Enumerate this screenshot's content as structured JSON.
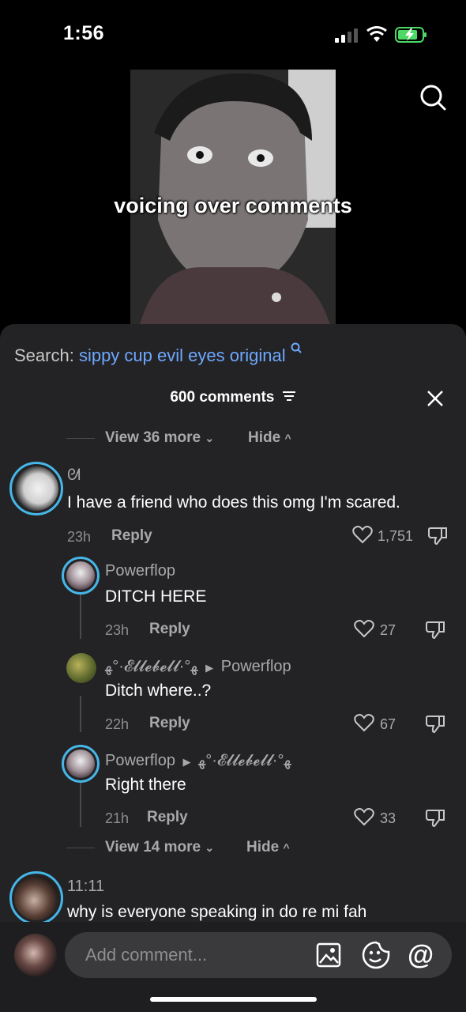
{
  "status_bar": {
    "time": "1:56"
  },
  "video": {
    "caption": "voicing over comments"
  },
  "search": {
    "prefix": "Search:",
    "query": "sippy cup evil eyes original"
  },
  "comments_header": {
    "count_label": "600 comments"
  },
  "thread_top": {
    "view_more": "View 36 more",
    "hide": "Hide"
  },
  "comments": [
    {
      "name": "ᘛ",
      "text": "I have a friend who does this omg I'm scared.",
      "time": "23h",
      "reply": "Reply",
      "likes": "1,751"
    },
    {
      "name": "Powerflop",
      "text": "DITCH HERE",
      "time": "23h",
      "reply": "Reply",
      "likes": "27"
    },
    {
      "name": "ﻬ°·𝓔𝓵𝓵𝓮𝓫𝓮𝓵𝓵·°ﻬ",
      "reply_to": "Powerflop",
      "text": "Ditch where..?",
      "time": "22h",
      "reply": "Reply",
      "likes": "67"
    },
    {
      "name": "Powerflop",
      "reply_to": "ﻬ°·𝓔𝓵𝓵𝓮𝓫𝓮𝓵𝓵·°ﻬ",
      "text": "Right there",
      "time": "21h",
      "reply": "Reply",
      "likes": "33"
    },
    {
      "name": "11:11",
      "text": "why is everyone speaking in do re mi fah"
    }
  ],
  "thread_bottom": {
    "view_more": "View 14 more",
    "hide": "Hide"
  },
  "composer": {
    "placeholder": "Add comment..."
  },
  "colors": {
    "accent_blue": "#6ea8ff",
    "ring": "#46b6e8",
    "battery_green": "#4cd964"
  }
}
